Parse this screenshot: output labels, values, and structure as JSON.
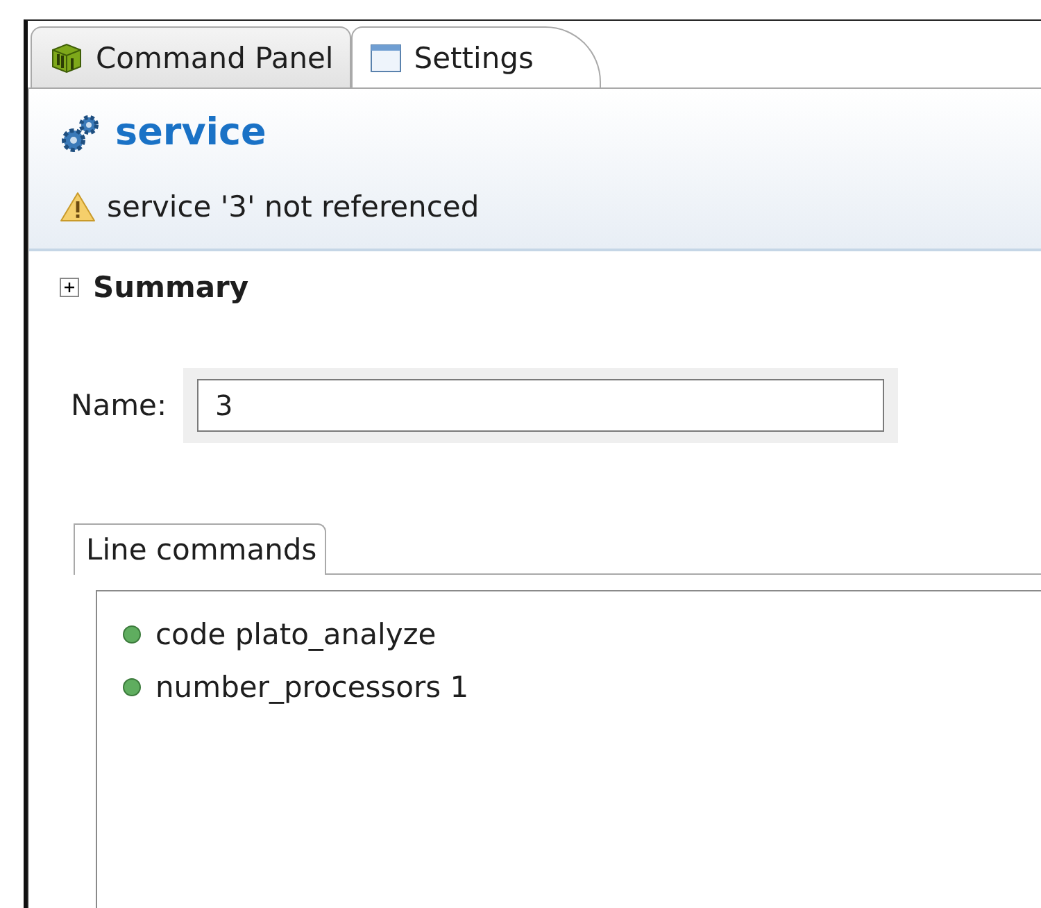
{
  "tabs": [
    {
      "label": "Command Panel",
      "kind": "cube",
      "selected": false
    },
    {
      "label": "Settings",
      "kind": "window",
      "selected": true
    }
  ],
  "header": {
    "title": "service",
    "message": "service '3' not referenced",
    "kind": "warning"
  },
  "summary": {
    "label": "Summary",
    "expanded": false
  },
  "name_field": {
    "label": "Name:",
    "value": "3"
  },
  "line_commands": {
    "tabs": [
      {
        "label": "Line commands",
        "selected": true
      }
    ],
    "items": [
      "code plato_analyze",
      "number_processors 1"
    ]
  }
}
